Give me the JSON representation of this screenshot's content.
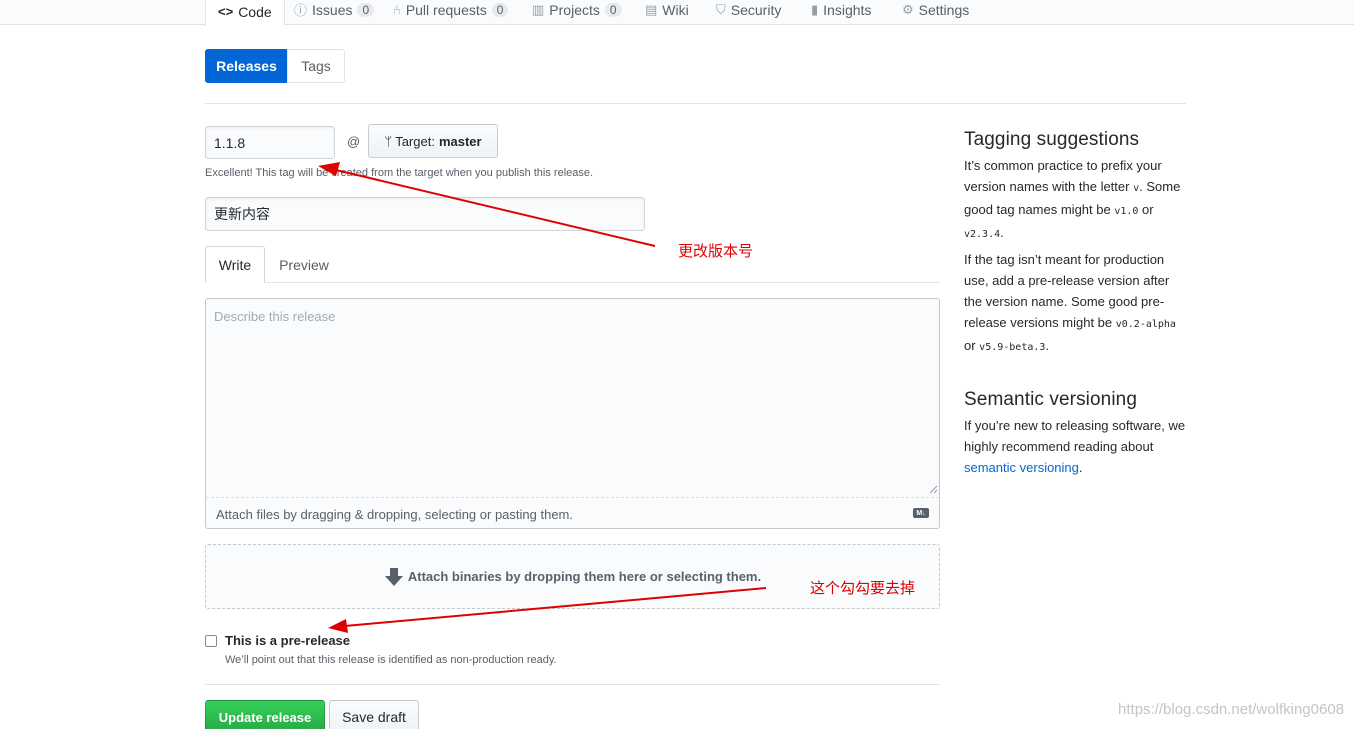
{
  "repo_nav": {
    "tabs": [
      {
        "label": "Code",
        "icon": "code-icon",
        "selected": true
      },
      {
        "label": "Issues",
        "icon": "issue-icon",
        "count": "0"
      },
      {
        "label": "Pull requests",
        "icon": "pull-request-icon",
        "count": "0"
      },
      {
        "label": "Projects",
        "icon": "project-icon",
        "count": "0"
      },
      {
        "label": "Wiki",
        "icon": "book-icon"
      },
      {
        "label": "Security",
        "icon": "shield-icon"
      },
      {
        "label": "Insights",
        "icon": "graph-icon"
      },
      {
        "label": "Settings",
        "icon": "gear-icon"
      }
    ]
  },
  "subnav": {
    "releases": "Releases",
    "tags": "Tags"
  },
  "form": {
    "tag_value": "1.1.8",
    "at_sign": "@",
    "target_label": "Target:",
    "target_branch": "master",
    "tag_note": "Excellent! This tag will be created from the target when you publish this release.",
    "title_value": "更新内容",
    "write_tab": "Write",
    "preview_tab": "Preview",
    "body_placeholder": "Describe this release",
    "attach_files": "Attach files by dragging & dropping, selecting or pasting them.",
    "markdown_badge": "M↓",
    "attach_binaries": "Attach binaries by dropping them here or selecting them.",
    "prerelease_label": "This is a pre-release",
    "prerelease_note": "We’ll point out that this release is identified as non-production ready.",
    "prerelease_checked": false,
    "update_button": "Update release",
    "draft_button": "Save draft"
  },
  "sidebar": {
    "tagging_title": "Tagging suggestions",
    "tagging_p1_a": "It’s common practice to prefix your version names with the letter ",
    "tagging_p1_v": "v",
    "tagging_p1_b": ". Some good tag names might be ",
    "tagging_p1_c1": "v1.0",
    "tagging_p1_or": " or ",
    "tagging_p1_c2": "v2.3.4",
    "tagging_p1_end": ".",
    "tagging_p2_a": "If the tag isn’t meant for production use, add a pre-release version after the version name. Some good pre-release versions might be ",
    "tagging_p2_c1": "v0.2-alpha",
    "tagging_p2_or": " or ",
    "tagging_p2_c2": "v5.9-beta.3",
    "tagging_p2_end": ".",
    "semver_title": "Semantic versioning",
    "semver_p_a": "If you’re new to releasing software, we highly recommend reading about ",
    "semver_link": "semantic versioning",
    "semver_p_end": "."
  },
  "annotations": {
    "version_note": "更改版本号",
    "checkbox_note": "这个勾勾要去掉",
    "color": "#e00000"
  },
  "watermark": "https://blog.csdn.net/wolfking0608"
}
